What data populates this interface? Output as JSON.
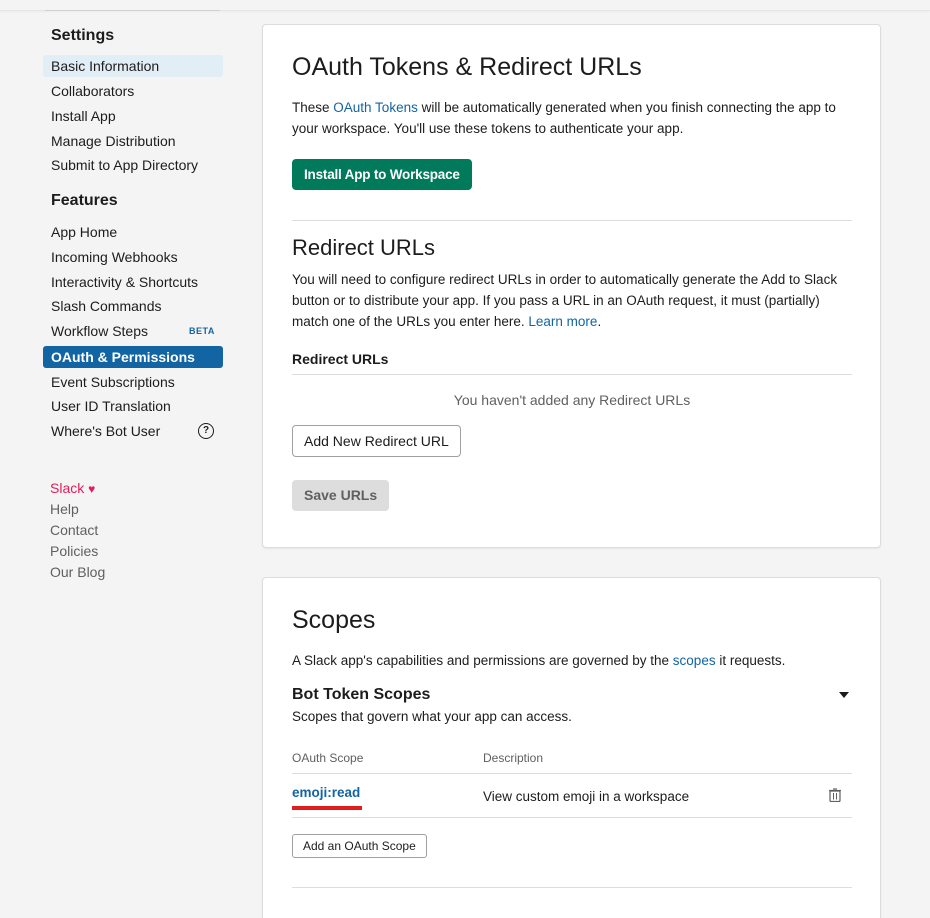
{
  "sidebar": {
    "settings_heading": "Settings",
    "settings_items": [
      {
        "label": "Basic Information"
      },
      {
        "label": "Collaborators"
      },
      {
        "label": "Install App"
      },
      {
        "label": "Manage Distribution"
      },
      {
        "label": "Submit to App Directory"
      }
    ],
    "features_heading": "Features",
    "features_items": [
      {
        "label": "App Home"
      },
      {
        "label": "Incoming Webhooks"
      },
      {
        "label": "Interactivity & Shortcuts"
      },
      {
        "label": "Slash Commands"
      },
      {
        "label": "Workflow Steps",
        "badge": "BETA"
      },
      {
        "label": "OAuth & Permissions"
      },
      {
        "label": "Event Subscriptions"
      },
      {
        "label": "User ID Translation"
      },
      {
        "label": "Where's Bot User",
        "icon": "help-icon",
        "icon_glyph": "?"
      }
    ],
    "footer": {
      "slack": "Slack",
      "heart_icon": "heart-icon",
      "heart_glyph": "♥",
      "help": "Help",
      "contact": "Contact",
      "policies": "Policies",
      "blog": "Our Blog"
    }
  },
  "oauth_card": {
    "title": "OAuth Tokens & Redirect URLs",
    "intro_pre": "These ",
    "intro_link": "OAuth Tokens",
    "intro_post": " will be automatically generated when you finish connecting the app to your workspace. You'll use these tokens to authenticate your app.",
    "install_button": "Install App to Workspace",
    "redirect_title": "Redirect URLs",
    "redirect_desc": "You will need to configure redirect URLs in order to automatically generate the Add to Slack button or to distribute your app. If you pass a URL in an OAuth request, it must (partially) match one of the URLs you enter here. ",
    "redirect_link": "Learn more",
    "redirect_desc_end": ".",
    "redirect_label": "Redirect URLs",
    "empty_text": "You haven't added any Redirect URLs",
    "add_button": "Add New Redirect URL",
    "save_button": "Save URLs"
  },
  "scopes_card": {
    "title": "Scopes",
    "intro_pre": "A Slack app's capabilities and permissions are governed by the ",
    "intro_link": "scopes",
    "intro_post": " it requests.",
    "bot_heading": "Bot Token Scopes",
    "bot_sub": "Scopes that govern what your app can access.",
    "caret_icon": "caret-down-icon",
    "col_scope": "OAuth Scope",
    "col_desc": "Description",
    "rows": [
      {
        "scope": "emoji:read",
        "description": "View custom emoji in a workspace",
        "icon": "trash-icon"
      }
    ],
    "add_scope_button": "Add an OAuth Scope"
  },
  "colors": {
    "accent": "#1264a3",
    "install_green": "#007a5a",
    "annotation_red": "#e01e1e",
    "slack_pink": "#e01e5a"
  }
}
